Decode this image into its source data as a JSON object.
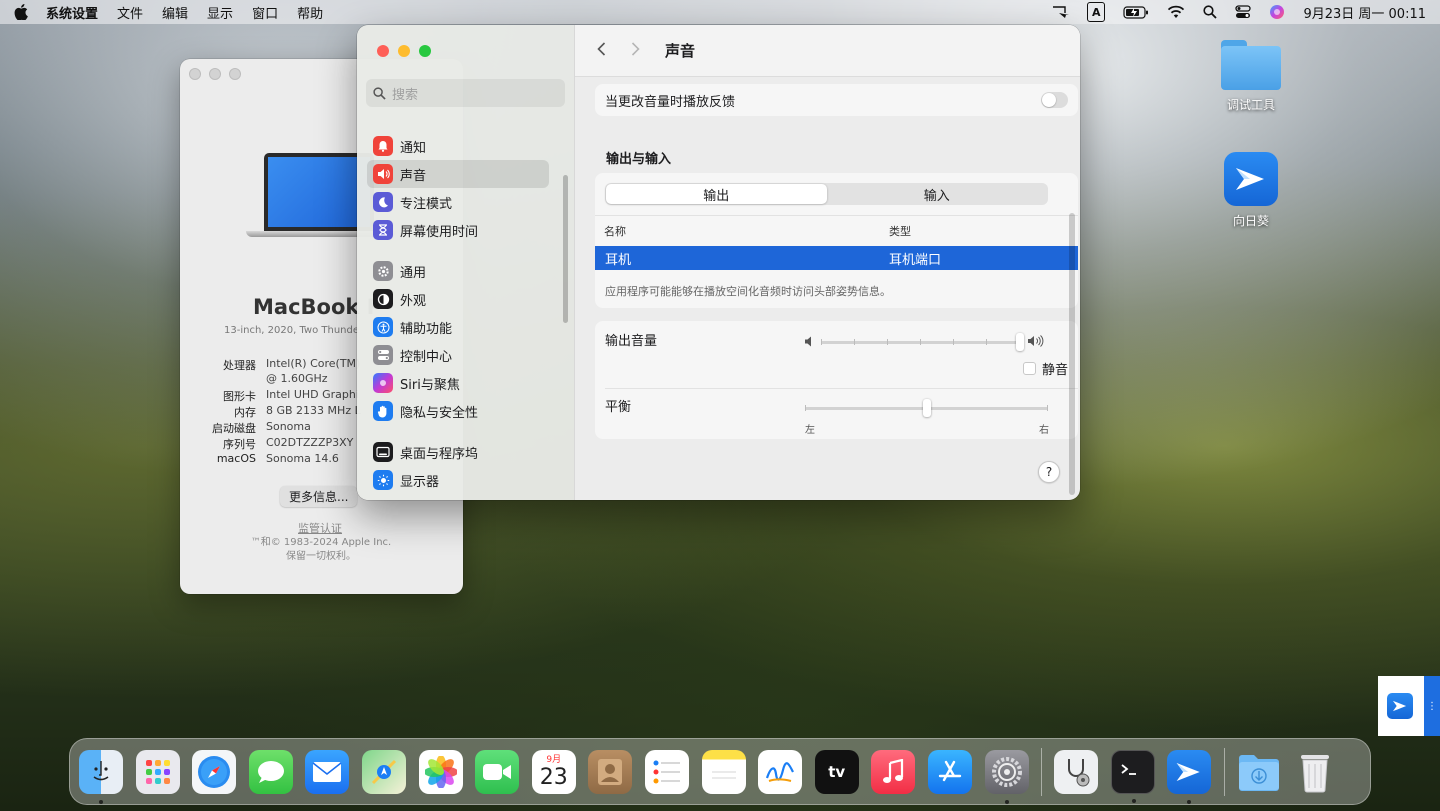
{
  "menubar": {
    "app_name": "系统设置",
    "items": [
      "文件",
      "编辑",
      "显示",
      "窗口",
      "帮助"
    ],
    "input_method": "A",
    "datetime": "9月23日 周一  00:11"
  },
  "about": {
    "model": "MacBook P",
    "model_sub": "13-inch, 2020, Two Thunde",
    "specs": [
      {
        "k": "处理器",
        "v": "Intel(R) Core(TM)"
      },
      {
        "k": "",
        "v": "@ 1.60GHz"
      },
      {
        "k": "图形卡",
        "v": "Intel UHD Graphi"
      },
      {
        "k": "内存",
        "v": "8 GB 2133 MHz L"
      },
      {
        "k": "启动磁盘",
        "v": "Sonoma"
      },
      {
        "k": "序列号",
        "v": "C02DTZZZP3XY"
      },
      {
        "k": "macOS",
        "v": "Sonoma 14.6"
      }
    ],
    "more_button": "更多信息...",
    "cert_link": "监管认证",
    "copyright_1": "™和© 1983-2024 Apple Inc.",
    "copyright_2": "保留一切权利。"
  },
  "settings": {
    "search_placeholder": "搜索",
    "nav": [
      {
        "label": "通知",
        "icon": "bell-icon",
        "color": "#f0433a"
      },
      {
        "label": "声音",
        "icon": "speaker-icon",
        "color": "#f0433a",
        "active": true
      },
      {
        "label": "专注模式",
        "icon": "moon-icon",
        "color": "#5b5bd6"
      },
      {
        "label": "屏幕使用时间",
        "icon": "hourglass-icon",
        "color": "#5b5bd6"
      },
      {
        "label": "通用",
        "icon": "gear-icon",
        "color": "#8e8e93"
      },
      {
        "label": "外观",
        "icon": "appearance-icon",
        "color": "#1c1c1e"
      },
      {
        "label": "辅助功能",
        "icon": "accessibility-icon",
        "color": "#1e7cf0"
      },
      {
        "label": "控制中心",
        "icon": "control-center-icon",
        "color": "#8e8e93"
      },
      {
        "label": "Siri与聚焦",
        "icon": "siri-icon",
        "color": "#c03ad6"
      },
      {
        "label": "隐私与安全性",
        "icon": "hand-icon",
        "color": "#1e7cf0"
      },
      {
        "label": "桌面与程序坞",
        "icon": "dock-icon",
        "color": "#1c1c1e"
      },
      {
        "label": "显示器",
        "icon": "display-icon",
        "color": "#1e7cf0"
      }
    ],
    "page_title": "声音",
    "feedback_label": "当更改音量时播放反馈",
    "feedback_on": false,
    "io_title": "输出与输入",
    "tabs": {
      "output": "输出",
      "input": "输入",
      "selected": "output"
    },
    "table": {
      "col_name": "名称",
      "col_type": "类型",
      "rows": [
        {
          "name": "耳机",
          "type": "耳机端口",
          "selected": true
        }
      ]
    },
    "io_note": "应用程序可能能够在播放空间化音频时访问头部姿势信息。",
    "output_volume_label": "输出音量",
    "output_volume": 1.0,
    "mute_label": "静音",
    "muted": false,
    "balance_label": "平衡",
    "balance": 0.5,
    "balance_left": "左",
    "balance_right": "右",
    "help": "?"
  },
  "desktop": {
    "icons": [
      {
        "label": "调试工具",
        "icon": "folder-icon"
      },
      {
        "label": "向日葵",
        "icon": "sunflower-app-icon"
      }
    ]
  },
  "dock": {
    "apps": [
      "finder-icon",
      "launchpad-icon",
      "safari-icon",
      "messages-icon",
      "mail-icon",
      "maps-icon",
      "photos-icon",
      "facetime-icon",
      "calendar-icon",
      "contacts-icon",
      "reminders-icon",
      "notes-icon",
      "freeform-icon",
      "tv-icon",
      "music-icon",
      "appstore-icon",
      "system-settings-icon",
      "disk-utility-icon",
      "terminal-icon",
      "sunflower-icon",
      "downloads-folder-icon",
      "trash-icon"
    ],
    "calendar_month": "9月",
    "calendar_day": "23",
    "tv_label": "tv"
  }
}
